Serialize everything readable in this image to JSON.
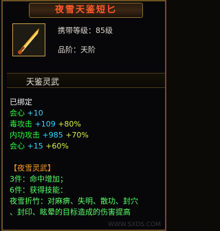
{
  "item": {
    "name": "夜雪天鉴短匕",
    "level_label": "携带等级：85级",
    "grade_label": "品阶：天阶",
    "icon": "dagger-icon"
  },
  "section_header": "天鉴灵武",
  "bound": "已绑定",
  "stats": [
    {
      "name": "会心",
      "value": "+10"
    },
    {
      "name": "毒攻击",
      "value": "+109",
      "bonus": "+80%"
    },
    {
      "name": "内功攻击",
      "value": "+985",
      "bonus": "+70%"
    },
    {
      "name": "会心",
      "value": "+15",
      "bonus": "+60%"
    }
  ],
  "set": {
    "name": "【夜雪灵武】",
    "bonus1": "3件：命中增加；",
    "bonus2": "6件：获得技能：",
    "skill_line1": "夜雪折竹：对麻痹、失明、散功、封穴",
    "skill_line2": "、封印、眩晕的目标造成的伤害提高"
  },
  "watermark": "WWW.SXDS.COM",
  "colors": {
    "title": "#ff5a2a",
    "stat_name": "#29ff3c",
    "stat_value": "#33d6ff",
    "stat_bonus": "#d8f040",
    "set_name": "#ff9a1e",
    "set_text": "#59ff6a"
  }
}
